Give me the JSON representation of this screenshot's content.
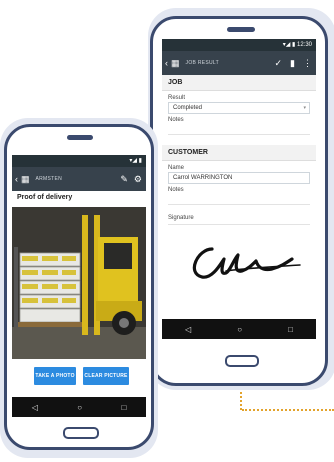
{
  "back_phone": {
    "status_time": "12:30",
    "appbar_title": "JOB RESULT",
    "job_section": "JOB",
    "result_label": "Result",
    "result_value": "Completed",
    "notes_label": "Notes",
    "customer_section": "CUSTOMER",
    "name_label": "Name",
    "name_value": "Carrol WARRINGTON",
    "notes_label_2": "Notes",
    "signature_label": "Signature"
  },
  "front_phone": {
    "appbar_title": "ARMSTEN",
    "screen_title": "Proof of delivery",
    "take_photo_label": "TAKE A PHOTO",
    "clear_picture_label": "CLEAR PICTURE"
  },
  "icons": {
    "back": "‹",
    "calendar": "▦",
    "check": "✓",
    "pencil": "✎",
    "menu": "⋮",
    "nav_back": "◁",
    "nav_home": "○",
    "nav_recent": "□"
  },
  "colors": {
    "phone_outline": "#3b4a6e",
    "appbar": "#37424c",
    "button": "#2c8be0",
    "dotted_line": "#e3a32c"
  }
}
